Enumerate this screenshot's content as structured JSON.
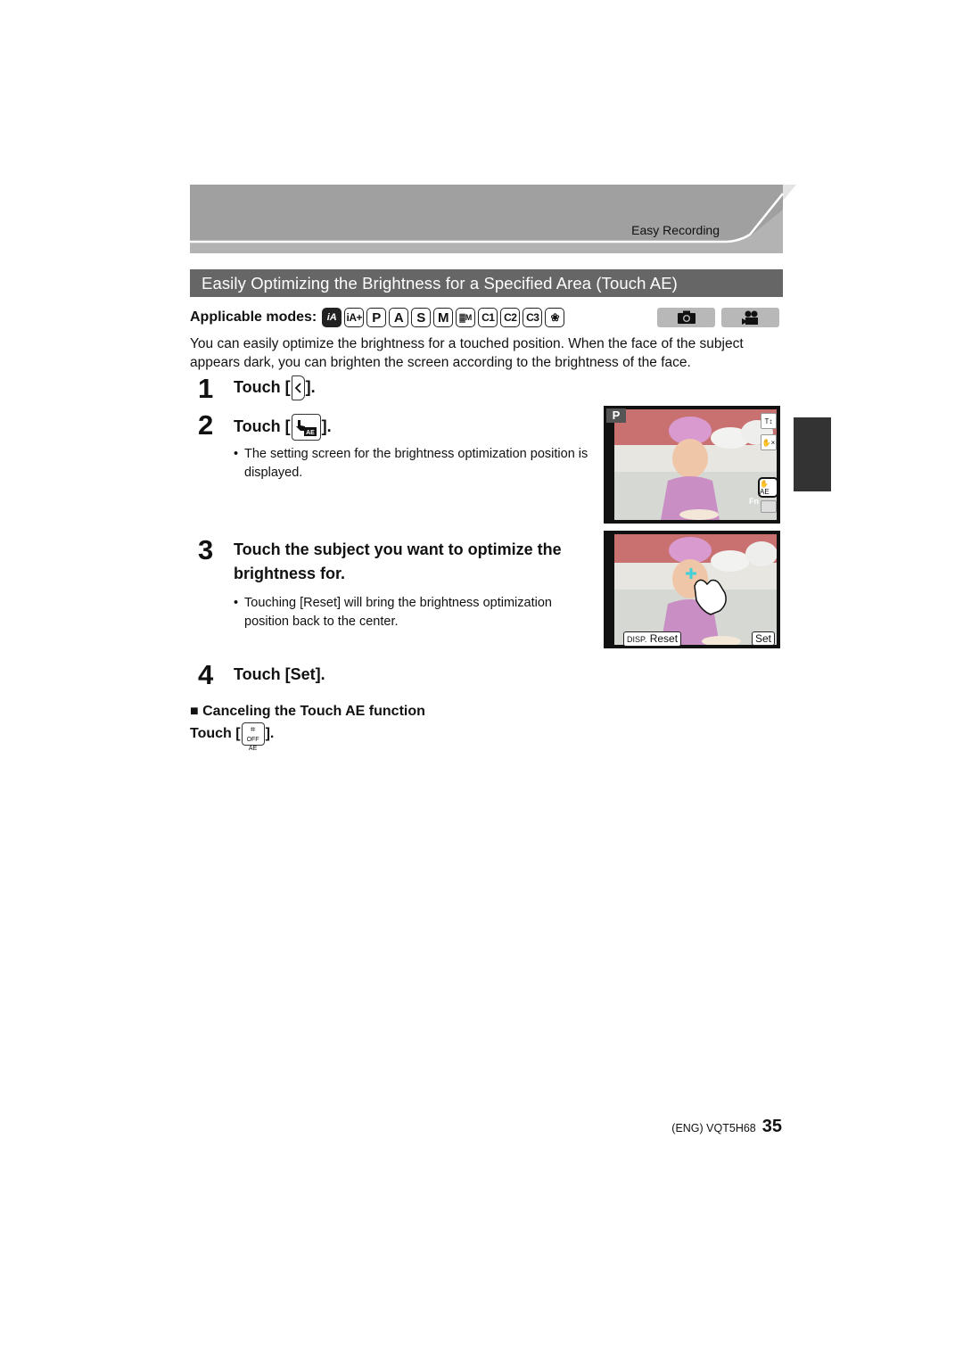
{
  "header": {
    "section_label": "Easy Recording"
  },
  "title": "Easily Optimizing the Brightness for a Specified Area (Touch AE)",
  "applicable_modes": {
    "label": "Applicable modes:",
    "modes": [
      "iA",
      "iA+",
      "P",
      "A",
      "S",
      "M",
      "▓M",
      "C1",
      "C2",
      "C3",
      "❀"
    ],
    "media": [
      "photo-camera-icon",
      "movie-camera-icon"
    ]
  },
  "intro": "You can easily optimize the brightness for a touched position. When the face of the subject appears dark, you can brighten the screen according to the brightness of the face.",
  "steps": [
    {
      "num": "1",
      "prefix": "Touch [",
      "suffix": "].",
      "icon": "tab-left-arrow-icon"
    },
    {
      "num": "2",
      "prefix": "Touch [",
      "suffix": "].",
      "icon": "touch-ae-icon",
      "bullet": "The setting screen for the brightness optimization position is displayed."
    },
    {
      "num": "3",
      "text": "Touch the subject you want to optimize the brightness for.",
      "bullet": "Touching [Reset] will bring the brightness optimization position back to the center."
    },
    {
      "num": "4",
      "text": "Touch [Set]."
    }
  ],
  "screens": {
    "first": {
      "mode_badge": "P",
      "side_icons": [
        "T/W zoom",
        "touch shutter off",
        "touch AE",
        "Fn"
      ],
      "fn_label": "Fn"
    },
    "second": {
      "disp_label": "DISP.",
      "reset_label": "Reset",
      "set_label": "Set"
    }
  },
  "cancel": {
    "heading": "■ Canceling the Touch AE function",
    "prefix": "Touch [",
    "suffix": "].",
    "icon_label": "OFF AE"
  },
  "footer": {
    "code": "(ENG) VQT5H68",
    "page": "35"
  }
}
